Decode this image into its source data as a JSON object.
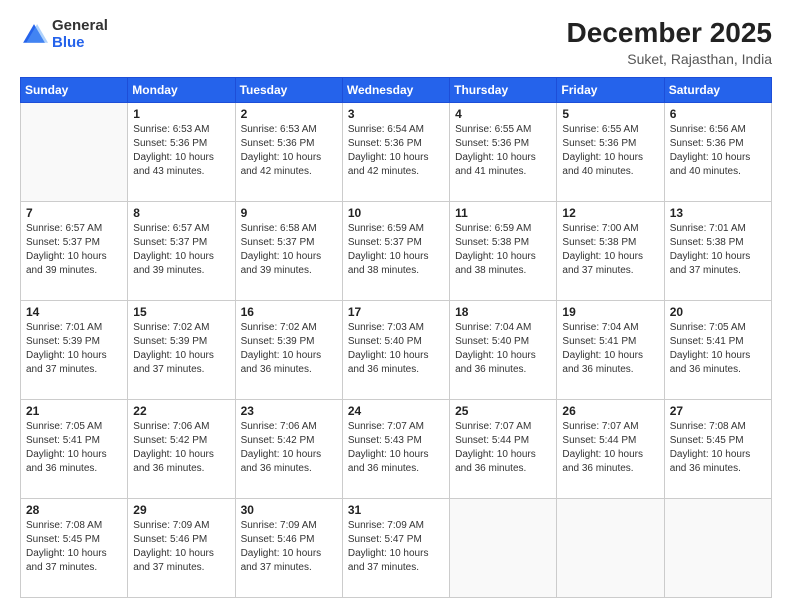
{
  "header": {
    "logo_general": "General",
    "logo_blue": "Blue",
    "main_title": "December 2025",
    "subtitle": "Suket, Rajasthan, India"
  },
  "calendar": {
    "days_of_week": [
      "Sunday",
      "Monday",
      "Tuesday",
      "Wednesday",
      "Thursday",
      "Friday",
      "Saturday"
    ],
    "weeks": [
      [
        {
          "day": "",
          "info": ""
        },
        {
          "day": "1",
          "info": "Sunrise: 6:53 AM\nSunset: 5:36 PM\nDaylight: 10 hours\nand 43 minutes."
        },
        {
          "day": "2",
          "info": "Sunrise: 6:53 AM\nSunset: 5:36 PM\nDaylight: 10 hours\nand 42 minutes."
        },
        {
          "day": "3",
          "info": "Sunrise: 6:54 AM\nSunset: 5:36 PM\nDaylight: 10 hours\nand 42 minutes."
        },
        {
          "day": "4",
          "info": "Sunrise: 6:55 AM\nSunset: 5:36 PM\nDaylight: 10 hours\nand 41 minutes."
        },
        {
          "day": "5",
          "info": "Sunrise: 6:55 AM\nSunset: 5:36 PM\nDaylight: 10 hours\nand 40 minutes."
        },
        {
          "day": "6",
          "info": "Sunrise: 6:56 AM\nSunset: 5:36 PM\nDaylight: 10 hours\nand 40 minutes."
        }
      ],
      [
        {
          "day": "7",
          "info": "Sunrise: 6:57 AM\nSunset: 5:37 PM\nDaylight: 10 hours\nand 39 minutes."
        },
        {
          "day": "8",
          "info": "Sunrise: 6:57 AM\nSunset: 5:37 PM\nDaylight: 10 hours\nand 39 minutes."
        },
        {
          "day": "9",
          "info": "Sunrise: 6:58 AM\nSunset: 5:37 PM\nDaylight: 10 hours\nand 39 minutes."
        },
        {
          "day": "10",
          "info": "Sunrise: 6:59 AM\nSunset: 5:37 PM\nDaylight: 10 hours\nand 38 minutes."
        },
        {
          "day": "11",
          "info": "Sunrise: 6:59 AM\nSunset: 5:38 PM\nDaylight: 10 hours\nand 38 minutes."
        },
        {
          "day": "12",
          "info": "Sunrise: 7:00 AM\nSunset: 5:38 PM\nDaylight: 10 hours\nand 37 minutes."
        },
        {
          "day": "13",
          "info": "Sunrise: 7:01 AM\nSunset: 5:38 PM\nDaylight: 10 hours\nand 37 minutes."
        }
      ],
      [
        {
          "day": "14",
          "info": "Sunrise: 7:01 AM\nSunset: 5:39 PM\nDaylight: 10 hours\nand 37 minutes."
        },
        {
          "day": "15",
          "info": "Sunrise: 7:02 AM\nSunset: 5:39 PM\nDaylight: 10 hours\nand 37 minutes."
        },
        {
          "day": "16",
          "info": "Sunrise: 7:02 AM\nSunset: 5:39 PM\nDaylight: 10 hours\nand 36 minutes."
        },
        {
          "day": "17",
          "info": "Sunrise: 7:03 AM\nSunset: 5:40 PM\nDaylight: 10 hours\nand 36 minutes."
        },
        {
          "day": "18",
          "info": "Sunrise: 7:04 AM\nSunset: 5:40 PM\nDaylight: 10 hours\nand 36 minutes."
        },
        {
          "day": "19",
          "info": "Sunrise: 7:04 AM\nSunset: 5:41 PM\nDaylight: 10 hours\nand 36 minutes."
        },
        {
          "day": "20",
          "info": "Sunrise: 7:05 AM\nSunset: 5:41 PM\nDaylight: 10 hours\nand 36 minutes."
        }
      ],
      [
        {
          "day": "21",
          "info": "Sunrise: 7:05 AM\nSunset: 5:41 PM\nDaylight: 10 hours\nand 36 minutes."
        },
        {
          "day": "22",
          "info": "Sunrise: 7:06 AM\nSunset: 5:42 PM\nDaylight: 10 hours\nand 36 minutes."
        },
        {
          "day": "23",
          "info": "Sunrise: 7:06 AM\nSunset: 5:42 PM\nDaylight: 10 hours\nand 36 minutes."
        },
        {
          "day": "24",
          "info": "Sunrise: 7:07 AM\nSunset: 5:43 PM\nDaylight: 10 hours\nand 36 minutes."
        },
        {
          "day": "25",
          "info": "Sunrise: 7:07 AM\nSunset: 5:44 PM\nDaylight: 10 hours\nand 36 minutes."
        },
        {
          "day": "26",
          "info": "Sunrise: 7:07 AM\nSunset: 5:44 PM\nDaylight: 10 hours\nand 36 minutes."
        },
        {
          "day": "27",
          "info": "Sunrise: 7:08 AM\nSunset: 5:45 PM\nDaylight: 10 hours\nand 36 minutes."
        }
      ],
      [
        {
          "day": "28",
          "info": "Sunrise: 7:08 AM\nSunset: 5:45 PM\nDaylight: 10 hours\nand 37 minutes."
        },
        {
          "day": "29",
          "info": "Sunrise: 7:09 AM\nSunset: 5:46 PM\nDaylight: 10 hours\nand 37 minutes."
        },
        {
          "day": "30",
          "info": "Sunrise: 7:09 AM\nSunset: 5:46 PM\nDaylight: 10 hours\nand 37 minutes."
        },
        {
          "day": "31",
          "info": "Sunrise: 7:09 AM\nSunset: 5:47 PM\nDaylight: 10 hours\nand 37 minutes."
        },
        {
          "day": "",
          "info": ""
        },
        {
          "day": "",
          "info": ""
        },
        {
          "day": "",
          "info": ""
        }
      ]
    ]
  }
}
